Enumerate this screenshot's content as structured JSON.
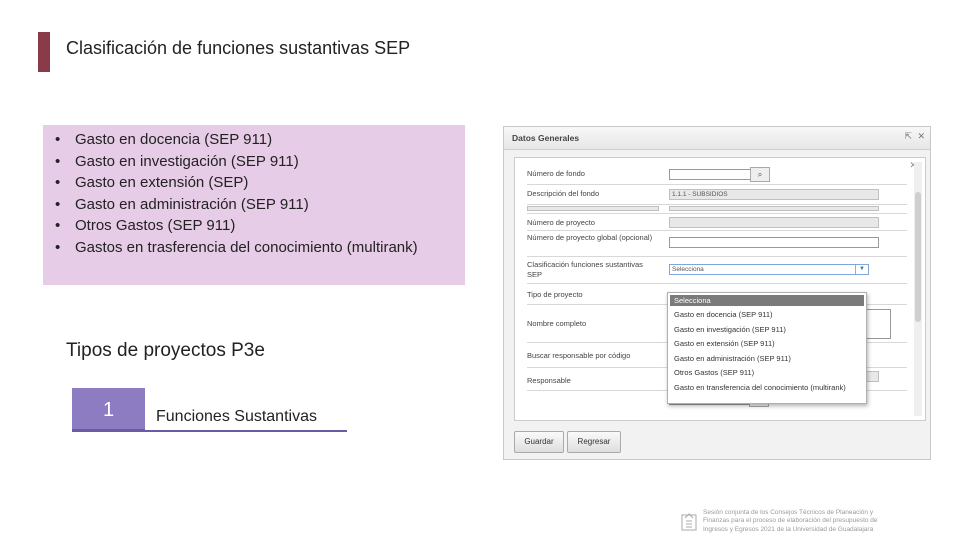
{
  "title": "Clasificación de funciones sustantivas SEP",
  "bullets": [
    "Gasto en docencia (SEP 911)",
    "Gasto en investigación (SEP 911)",
    "Gasto en extensión (SEP)",
    "Gasto en administración (SEP 911)",
    "Otros Gastos (SEP 911)",
    "Gastos en trasferencia del conocimiento (multirank)"
  ],
  "bullet_symbol": "•",
  "subtitle": "Tipos de proyectos P3e",
  "step": {
    "number": "1",
    "label": "Funciones Sustantivas"
  },
  "form": {
    "window_title": "Datos Generales",
    "fields": {
      "numero_fondo": "Número de fondo",
      "descripcion_fondo": "Descripción del fondo",
      "descripcion_value": "1.1.1 - SUBSIDIOS",
      "numero_proyecto": "Número de proyecto",
      "numero_global": "Número de proyecto global (opcional)",
      "clasificacion": "Clasificación funciones sustantivas SEP",
      "clasificacion_value": "Selecciona",
      "tipo_proyecto": "Tipo de proyecto",
      "nombre_completo": "Nombre completo",
      "buscar_responsable": "Buscar responsable por código",
      "responsable": "Responsable"
    },
    "dropdown_options": [
      "Selecciona",
      "Gasto en docencia (SEP 911)",
      "Gasto en investigación (SEP 911)",
      "Gasto en extensión (SEP 911)",
      "Gasto en administración (SEP 911)",
      "Otros Gastos (SEP 911)",
      "Gasto en transferencia del conocimiento (multirank)"
    ],
    "buttons": {
      "save": "Guardar",
      "back": "Regresar"
    }
  },
  "footer": [
    "Sesión conjunta de los Consejos Técnicos de Planeación y",
    "Finanzas para el proceso de elaboración del presupuesto de",
    "Ingresos y Egresos 2021 de la Universidad de Guadalajara"
  ],
  "colors": {
    "accent_bar": "#8b3a4a",
    "bullet_bg": "#e6cce6",
    "step_box": "#8e7cc3"
  }
}
